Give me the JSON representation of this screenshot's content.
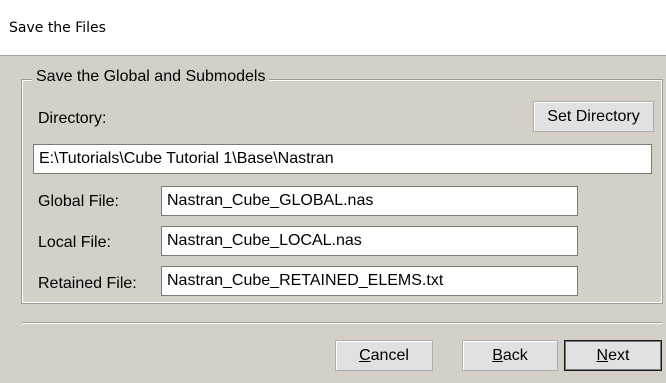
{
  "header": {
    "title": "Save the Files"
  },
  "group": {
    "title": "Save the Global and Submodels"
  },
  "directory": {
    "label": "Directory:",
    "set_button": "Set Directory",
    "value": "E:\\Tutorials\\Cube Tutorial 1\\Base\\Nastran"
  },
  "files": {
    "global_label": "Global File:",
    "global_value": "Nastran_Cube_GLOBAL.nas",
    "local_label": "Local File:",
    "local_value": "Nastran_Cube_LOCAL.nas",
    "retained_label": "Retained File:",
    "retained_value": "Nastran_Cube_RETAINED_ELEMS.txt"
  },
  "buttons": {
    "cancel_first": "C",
    "cancel_rest": "ancel",
    "back_first": "B",
    "back_rest": "ack",
    "next_first": "N",
    "next_rest": "ext"
  }
}
